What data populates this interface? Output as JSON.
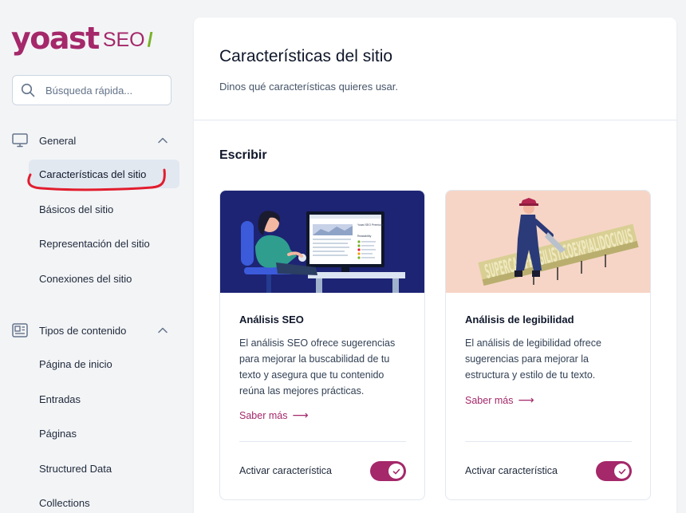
{
  "brand": {
    "name": "yoast",
    "product": "SEO",
    "slash": "/",
    "primary_color": "#a4286a",
    "accent_color": "#77b227"
  },
  "search": {
    "placeholder": "Búsqueda rápida..."
  },
  "sidebar": {
    "groups": [
      {
        "label": "General",
        "icon": "desktop-icon",
        "items": [
          {
            "label": "Características del sitio",
            "active": true
          },
          {
            "label": "Básicos del sitio"
          },
          {
            "label": "Representación del sitio"
          },
          {
            "label": "Conexiones del sitio"
          }
        ]
      },
      {
        "label": "Tipos de contenido",
        "icon": "content-types-icon",
        "items": [
          {
            "label": "Página de inicio"
          },
          {
            "label": "Entradas"
          },
          {
            "label": "Páginas"
          },
          {
            "label": "Structured Data"
          },
          {
            "label": "Collections"
          }
        ]
      }
    ]
  },
  "main": {
    "title": "Características del sitio",
    "subtitle": "Dinos qué características quieres usar.",
    "section_title": "Escribir",
    "cards": [
      {
        "title": "Análisis SEO",
        "description": "El análisis SEO ofrece sugerencias para mejorar la buscabilidad de tu texto y asegura que tu contenido reúna las mejores prácticas.",
        "link": "Saber más",
        "toggle_label": "Activar característica",
        "enabled": true
      },
      {
        "title": "Análisis de legibilidad",
        "description": "El análisis de legibilidad ofrece sugerencias para mejorar la estructura y estilo de tu texto.",
        "link": "Saber más",
        "toggle_label": "Activar característica",
        "enabled": true
      }
    ],
    "illustration_text": "SUPERCALIFRAGILISTICOEXPIALIDOCIOUS",
    "screen_text": {
      "heading": "Yoast SEO Premium",
      "subheading": "Readability"
    }
  },
  "annotation_color": "#e11d2e"
}
